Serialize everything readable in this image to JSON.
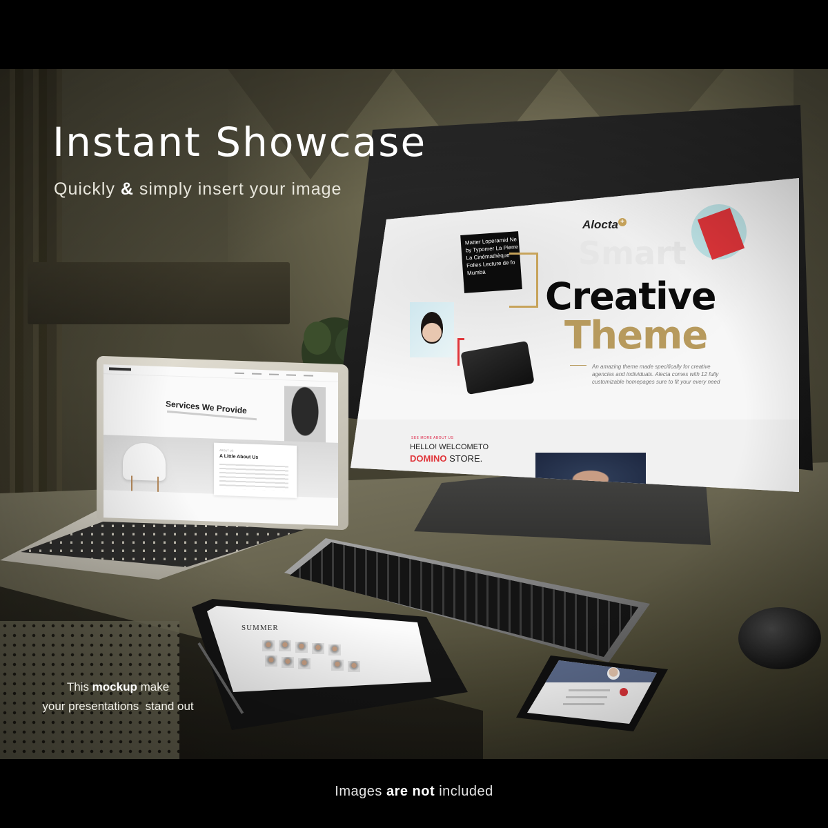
{
  "headline": {
    "title": "Instant Showcase",
    "subtitle_before": "Quickly ",
    "subtitle_emphasis": "&",
    "subtitle_after": " simply insert your image"
  },
  "tagline": {
    "line1_before": "This ",
    "line1_emphasis": "mockup",
    "line1_after": " make",
    "line2": "your presentations  stand out"
  },
  "footer": {
    "before": "Images ",
    "emphasis": "are not",
    "after": " included"
  },
  "monitor_screen": {
    "logo": "Alocta",
    "logo_plus": "+",
    "ghost_word": "Smart",
    "heading_line1": "Creative",
    "heading_line2": "Theme",
    "intro": "An amazing theme made specifically for creative agencies and individuals. Alecta comes with 12 fully customizable homepages sure to fit your every need",
    "poster_text": "Matter Loperamid Ne\nby Typomer La Pierre\nLa Cinémathèque\nFolies Lecture de fo\nMumba",
    "welcome_kicker": "SEE MORE ABOUT US",
    "welcome": "HELLO! WELCOMETO",
    "store_brand": "DOMINO",
    "store_word": " STORE."
  },
  "laptop_screen": {
    "services_title": "Services We Provide",
    "about_kicker": "ABOUT US",
    "about_title": "A Little About Us"
  },
  "tablet_screen": {
    "title": "SUMMER"
  },
  "colors": {
    "gold": "#b79a5d",
    "red": "#e0353a",
    "background": "#000000"
  }
}
